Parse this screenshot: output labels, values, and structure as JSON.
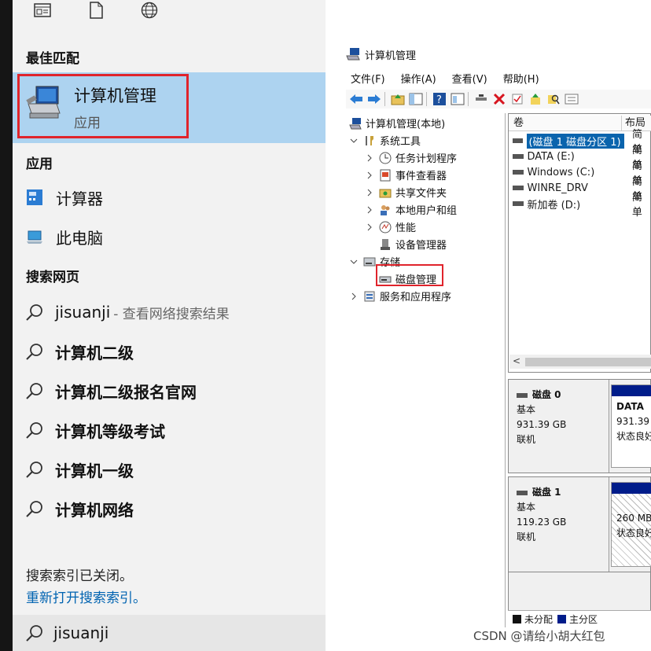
{
  "start_menu": {
    "best_match_heading": "最佳匹配",
    "best_match": {
      "title": "计算机管理",
      "subtitle": "应用"
    },
    "apps_heading": "应用",
    "apps": [
      {
        "label": "计算器",
        "icon": "calculator-icon"
      },
      {
        "label": "此电脑",
        "icon": "this-pc-icon"
      }
    ],
    "web_heading": "搜索网页",
    "web_results": [
      {
        "label": "jisuanji",
        "hint": "- 查看网络搜索结果",
        "bold": false
      },
      {
        "label": "计算机二级",
        "hint": "",
        "bold": true
      },
      {
        "label": "计算机二级报名官网",
        "hint": "",
        "bold": true
      },
      {
        "label": "计算机等级考试",
        "hint": "",
        "bold": true
      },
      {
        "label": "计算机一级",
        "hint": "",
        "bold": true
      },
      {
        "label": "计算机网络",
        "hint": "",
        "bold": true
      }
    ],
    "index_notice": "搜索索引已关闭。",
    "index_link": "重新打开搜索索引。",
    "search_value": "jisuanji"
  },
  "mmc": {
    "title": "计算机管理",
    "menu": [
      "文件(F)",
      "操作(A)",
      "查看(V)",
      "帮助(H)"
    ],
    "tree": [
      {
        "label": "计算机管理(本地)",
        "level": 0,
        "arrow": "",
        "icon": "computer-management-icon"
      },
      {
        "label": "系统工具",
        "level": 1,
        "arrow": "down",
        "icon": "tools-icon"
      },
      {
        "label": "任务计划程序",
        "level": 2,
        "arrow": "right",
        "icon": "clock-icon"
      },
      {
        "label": "事件查看器",
        "level": 2,
        "arrow": "right",
        "icon": "event-viewer-icon"
      },
      {
        "label": "共享文件夹",
        "level": 2,
        "arrow": "right",
        "icon": "shared-folder-icon"
      },
      {
        "label": "本地用户和组",
        "level": 2,
        "arrow": "right",
        "icon": "users-icon"
      },
      {
        "label": "性能",
        "level": 2,
        "arrow": "right",
        "icon": "performance-icon"
      },
      {
        "label": "设备管理器",
        "level": 2,
        "arrow": "",
        "icon": "device-manager-icon"
      },
      {
        "label": "存储",
        "level": 1,
        "arrow": "down",
        "icon": "storage-icon"
      },
      {
        "label": "磁盘管理",
        "level": 2,
        "arrow": "",
        "icon": "disk-management-icon"
      },
      {
        "label": "服务和应用程序",
        "level": 1,
        "arrow": "right",
        "icon": "services-icon"
      }
    ],
    "volume_columns": [
      "卷",
      "布局"
    ],
    "volumes": [
      {
        "name": "(磁盘 1 磁盘分区 1)",
        "layout": "简单",
        "selected": true
      },
      {
        "name": "DATA (E:)",
        "layout": "简单",
        "selected": false
      },
      {
        "name": "Windows (C:)",
        "layout": "简单",
        "selected": false
      },
      {
        "name": "WINRE_DRV",
        "layout": "简单",
        "selected": false
      },
      {
        "name": "新加卷 (D:)",
        "layout": "简单",
        "selected": false
      }
    ],
    "scroll_left": "<",
    "disks": [
      {
        "name": "磁盘 0",
        "type": "基本",
        "size": "931.39 GB",
        "status": "联机",
        "part_name": "DATA",
        "part_size": "931.39",
        "part_status": "状态良好"
      },
      {
        "name": "磁盘 1",
        "type": "基本",
        "size": "119.23 GB",
        "status": "联机",
        "part_name": "",
        "part_size": "260 MB",
        "part_status": "状态良好"
      }
    ],
    "legend": [
      {
        "label": "未分配",
        "color": "#111111"
      },
      {
        "label": "主分区",
        "color": "#001c8a"
      }
    ]
  },
  "watermark": "CSDN @请给小胡大红包"
}
